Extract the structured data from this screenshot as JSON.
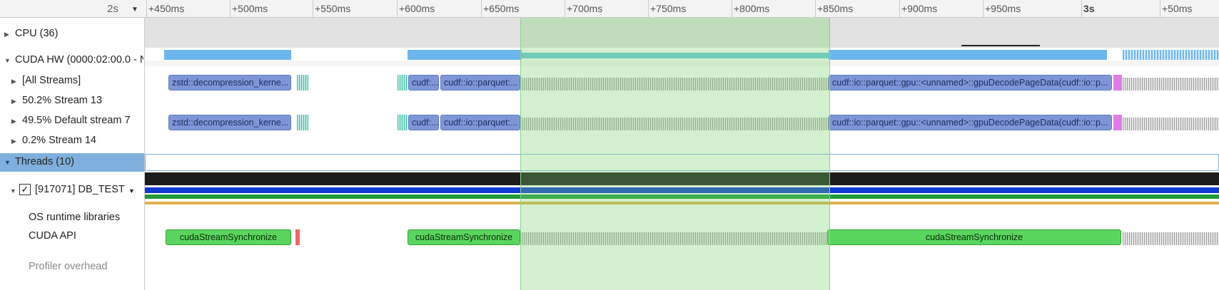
{
  "ruler": {
    "zoom": "2s",
    "ticks": [
      {
        "label": "+450ms",
        "bold": false
      },
      {
        "label": "+500ms",
        "bold": false
      },
      {
        "label": "+550ms",
        "bold": false
      },
      {
        "label": "+600ms",
        "bold": false
      },
      {
        "label": "+650ms",
        "bold": false
      },
      {
        "label": "+700ms",
        "bold": false
      },
      {
        "label": "+750ms",
        "bold": false
      },
      {
        "label": "+800ms",
        "bold": false
      },
      {
        "label": "+850ms",
        "bold": false
      },
      {
        "label": "+900ms",
        "bold": false
      },
      {
        "label": "+950ms",
        "bold": false
      },
      {
        "label": "3s",
        "bold": true
      },
      {
        "label": "+50ms",
        "bold": false
      }
    ]
  },
  "rows": {
    "cpu": "CPU (36)",
    "cuda_hw": "CUDA HW (0000:02:00.0 - N",
    "all_streams": "[All Streams]",
    "stream13": "50.2% Stream 13",
    "default_stream": "49.5% Default stream 7",
    "stream14": "0.2% Stream 14",
    "threads": "Threads (10)",
    "thread": "[917071] DB_TEST",
    "os_runtime": "OS runtime libraries",
    "cuda_api": "CUDA API",
    "profiler_overhead": "Profiler overhead"
  },
  "kernels": {
    "zstd": "zstd::decompression_kerne...",
    "cudf_short": "cudf:...",
    "cudf_parquet": "cudf::io::parquet:...",
    "decode": "cudf::io::parquet::gpu::<unnamed>::gpuDecodePageData(cudf::io::p..."
  },
  "api_calls": {
    "sync": "cudaStreamSynchronize"
  },
  "colors": {
    "selection": "#b9e8b5",
    "kernel": "#7e96d8",
    "api": "#5ad65e",
    "threads_header": "#7fb0dd"
  }
}
